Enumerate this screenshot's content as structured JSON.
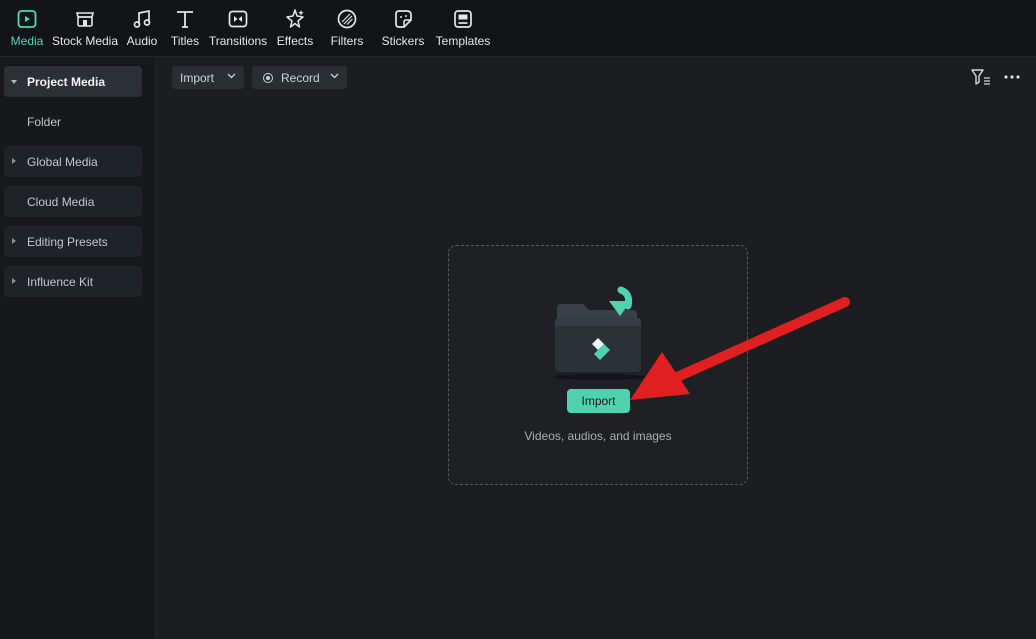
{
  "toolbar": {
    "items": [
      {
        "label": "Media",
        "icon": "media-icon",
        "active": true
      },
      {
        "label": "Stock Media",
        "icon": "stock-media-icon"
      },
      {
        "label": "Audio",
        "icon": "music-note-icon"
      },
      {
        "label": "Titles",
        "icon": "text-t-icon"
      },
      {
        "label": "Transitions",
        "icon": "transition-icon"
      },
      {
        "label": "Effects",
        "icon": "sparkle-effects-icon"
      },
      {
        "label": "Filters",
        "icon": "filter-circle-icon"
      },
      {
        "label": "Stickers",
        "icon": "sticker-icon"
      },
      {
        "label": "Templates",
        "icon": "template-icon"
      }
    ],
    "accent_color": "#4fd8b8"
  },
  "sidebar": {
    "items": [
      {
        "label": "Project Media",
        "expanded": true,
        "active": true
      },
      {
        "label": "Folder"
      },
      {
        "label": "Global Media",
        "collapsed": true
      },
      {
        "label": "Cloud Media"
      },
      {
        "label": "Editing Presets",
        "collapsed": true
      },
      {
        "label": "Influence Kit",
        "collapsed": true
      }
    ]
  },
  "subbar": {
    "import_label": "Import",
    "record_label": "Record"
  },
  "dropzone": {
    "button_label": "Import",
    "hint": "Videos, audios, and images",
    "button_color": "#4fd2ad"
  },
  "annotation": {
    "arrow_color": "#e02020"
  }
}
